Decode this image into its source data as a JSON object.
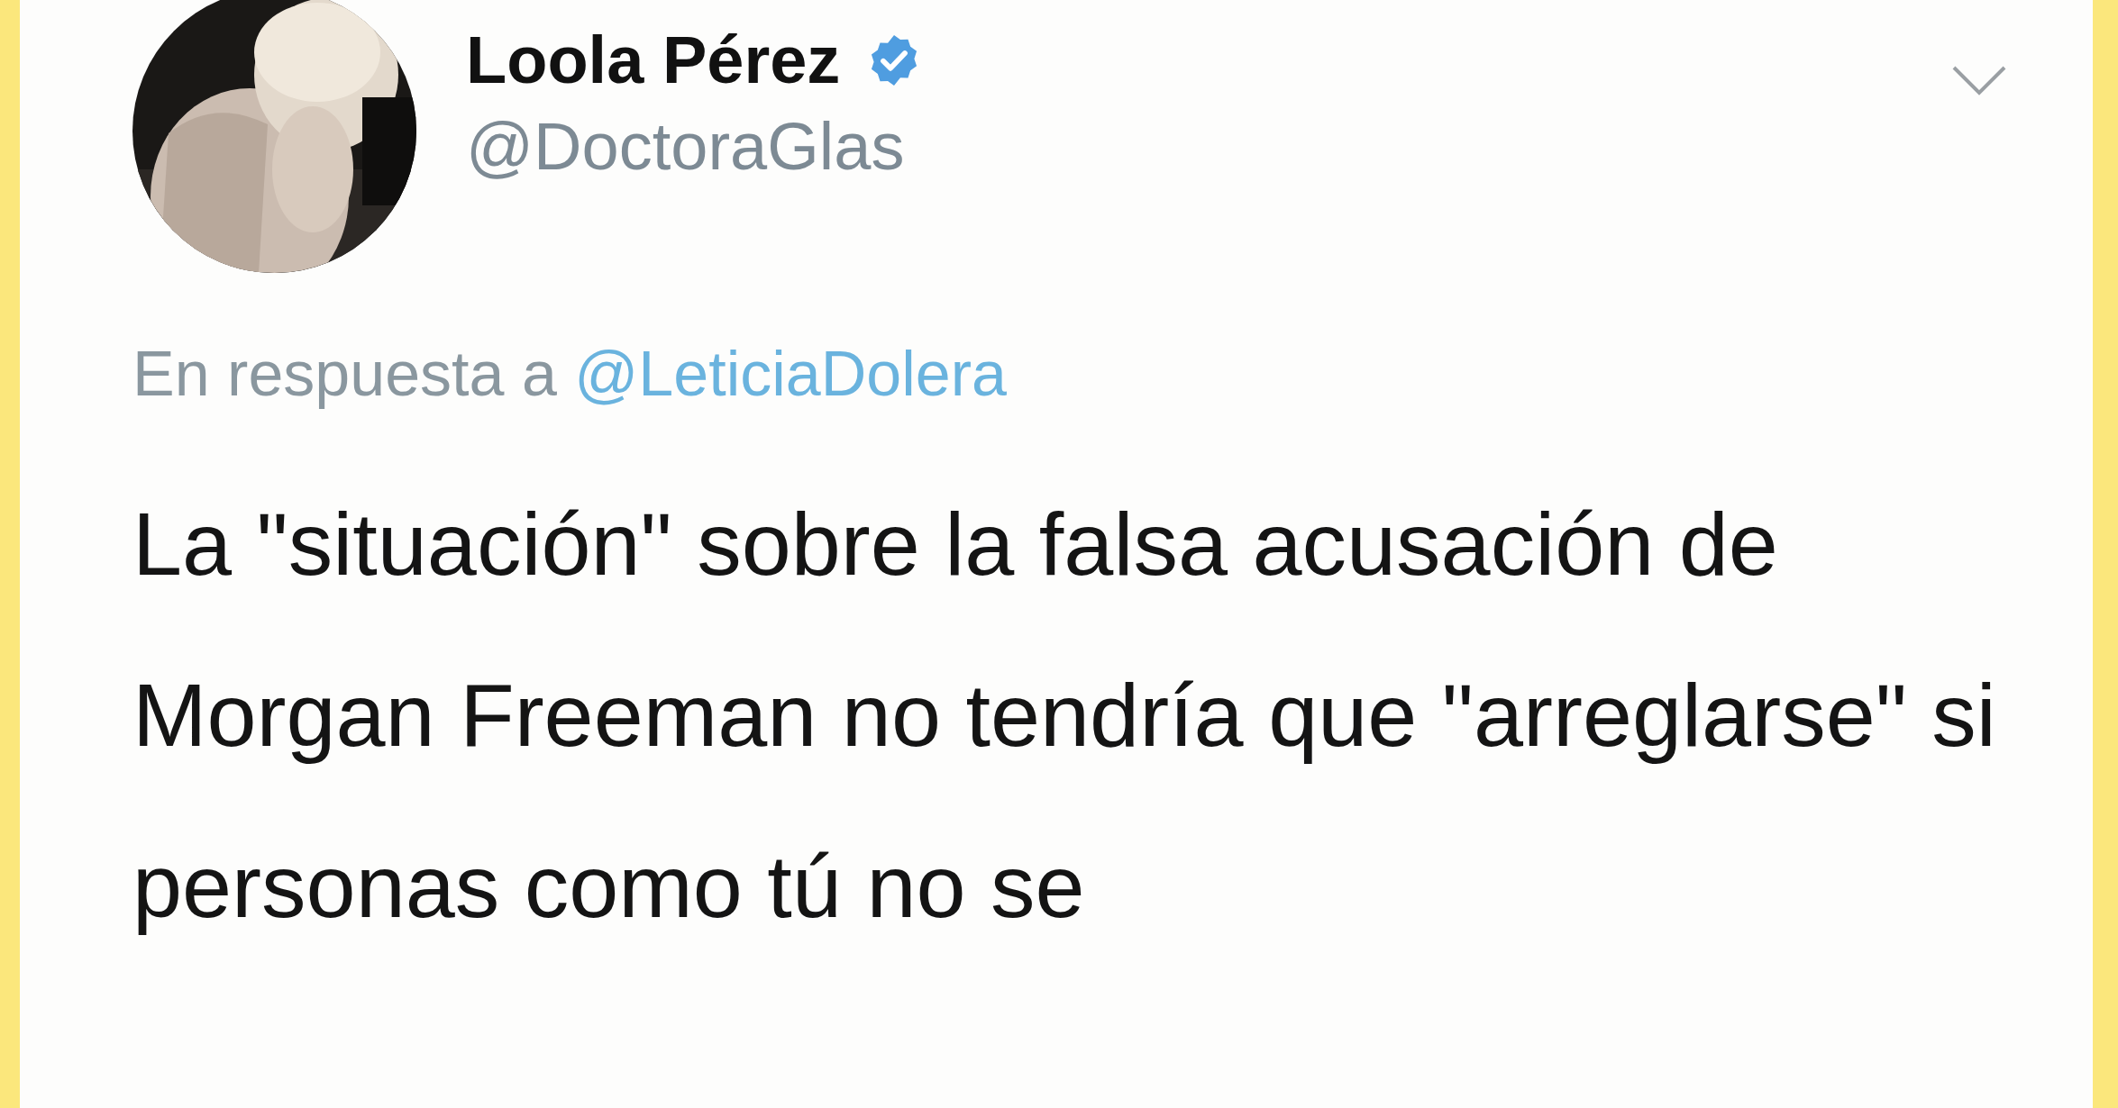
{
  "tweet": {
    "author": {
      "name": "Loola Pérez",
      "verified": true,
      "handle": "@DoctoraGlas"
    },
    "reply_to": {
      "label": "En respuesta a",
      "handle": "@LeticiaDolera"
    },
    "text": "La \"situación\" sobre la falsa acusación de Morgan Freeman no tendría que \"arreglarse\" si personas como tú no se"
  }
}
